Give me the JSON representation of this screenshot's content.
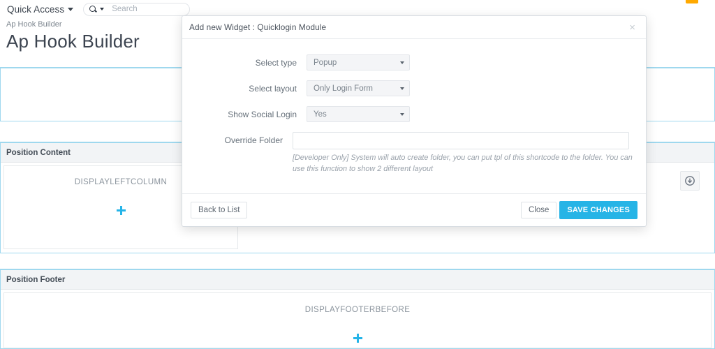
{
  "topbar": {
    "quick_access_label": "Quick Access",
    "search_placeholder": "Search",
    "search_value": ""
  },
  "header": {
    "breadcrumb": "Ap Hook Builder",
    "page_title": "Ap Hook Builder"
  },
  "panels": [
    {
      "title": "Position Content",
      "hook_label": "DISPLAYLEFTCOLUMN"
    },
    {
      "title": "Position Footer",
      "hook_label": "DISPLAYFOOTERBEFORE"
    }
  ],
  "modal": {
    "title": "Add new Widget : Quicklogin Module",
    "close_glyph": "×",
    "fields": [
      {
        "label": "Select type",
        "value": "Popup"
      },
      {
        "label": "Select layout",
        "value": "Only Login Form"
      },
      {
        "label": "Show Social Login",
        "value": "Yes"
      }
    ],
    "override": {
      "label": "Override Folder",
      "value": "",
      "help": "[Developer Only] System will auto create folder, you can put tpl of this shortcode to the folder. You can use this function to show 2 different layout"
    },
    "buttons": {
      "back": "Back to List",
      "close": "Close",
      "save": "SAVE CHANGES"
    }
  },
  "colors": {
    "accent": "#26b4e6",
    "panel_border": "#9fd8ee",
    "orange": "#ffa900"
  }
}
